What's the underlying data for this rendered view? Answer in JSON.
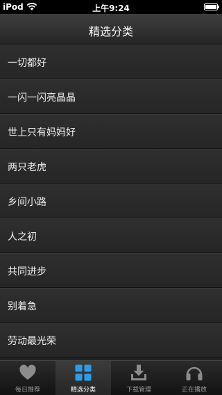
{
  "status_bar": {
    "carrier": "iPod",
    "time": "上午9:24"
  },
  "nav": {
    "title": "精选分类"
  },
  "categories": [
    {
      "label": "一切都好"
    },
    {
      "label": "一闪一闪亮晶晶"
    },
    {
      "label": "世上只有妈妈好"
    },
    {
      "label": "两只老虎"
    },
    {
      "label": "乡间小路"
    },
    {
      "label": "人之初"
    },
    {
      "label": "共同进步"
    },
    {
      "label": "别着急"
    },
    {
      "label": "劳动最光荣"
    }
  ],
  "tabs": [
    {
      "label": "每日推荐",
      "icon": "heart-icon",
      "active": false
    },
    {
      "label": "精选分类",
      "icon": "grid-icon",
      "active": true
    },
    {
      "label": "下载管理",
      "icon": "download-icon",
      "active": false
    },
    {
      "label": "正在播放",
      "icon": "headphones-icon",
      "active": false
    }
  ],
  "colors": {
    "background": "#222222",
    "active_tab_icon": "#2f9be8",
    "inactive_tab_icon": "#8c8c8c"
  }
}
